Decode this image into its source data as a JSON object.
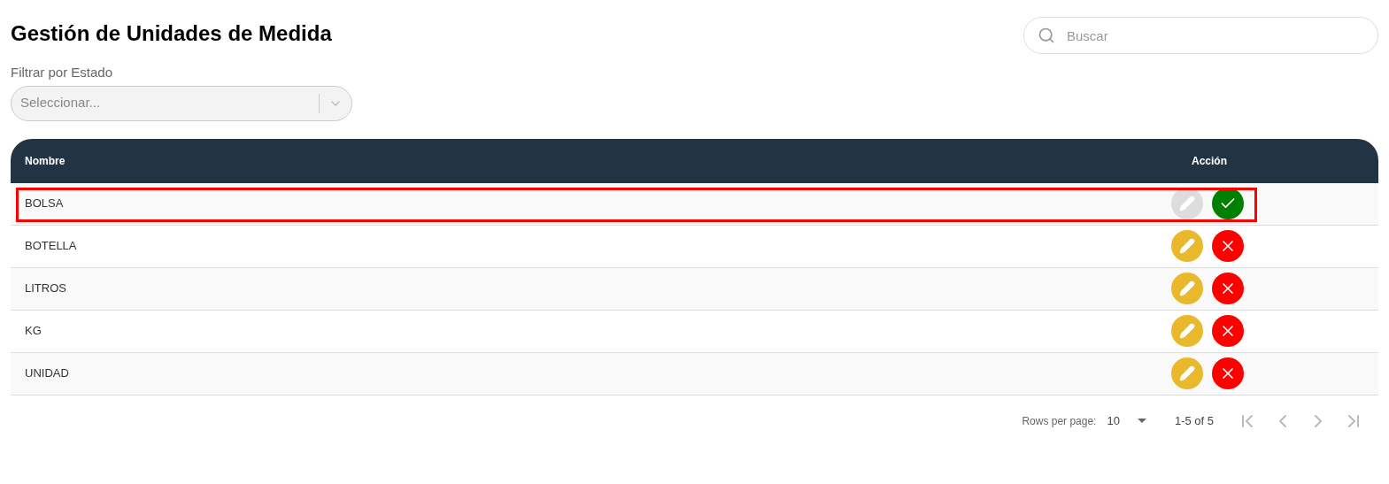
{
  "title": "Gestión de Unidades de Medida",
  "search": {
    "placeholder": "Buscar"
  },
  "filter": {
    "label": "Filtrar por Estado",
    "placeholder": "Seleccionar..."
  },
  "table": {
    "columns": [
      "Nombre",
      "Acción"
    ],
    "rows": [
      {
        "name": "BOLSA",
        "active": false,
        "highlighted": true
      },
      {
        "name": "BOTELLA",
        "active": true,
        "highlighted": false
      },
      {
        "name": "LITROS",
        "active": true,
        "highlighted": false
      },
      {
        "name": "KG",
        "active": true,
        "highlighted": false
      },
      {
        "name": "UNIDAD",
        "active": true,
        "highlighted": false
      }
    ]
  },
  "pagination": {
    "rows_label": "Rows per page:",
    "rows_value": "10",
    "range": "1-5 of 5"
  }
}
